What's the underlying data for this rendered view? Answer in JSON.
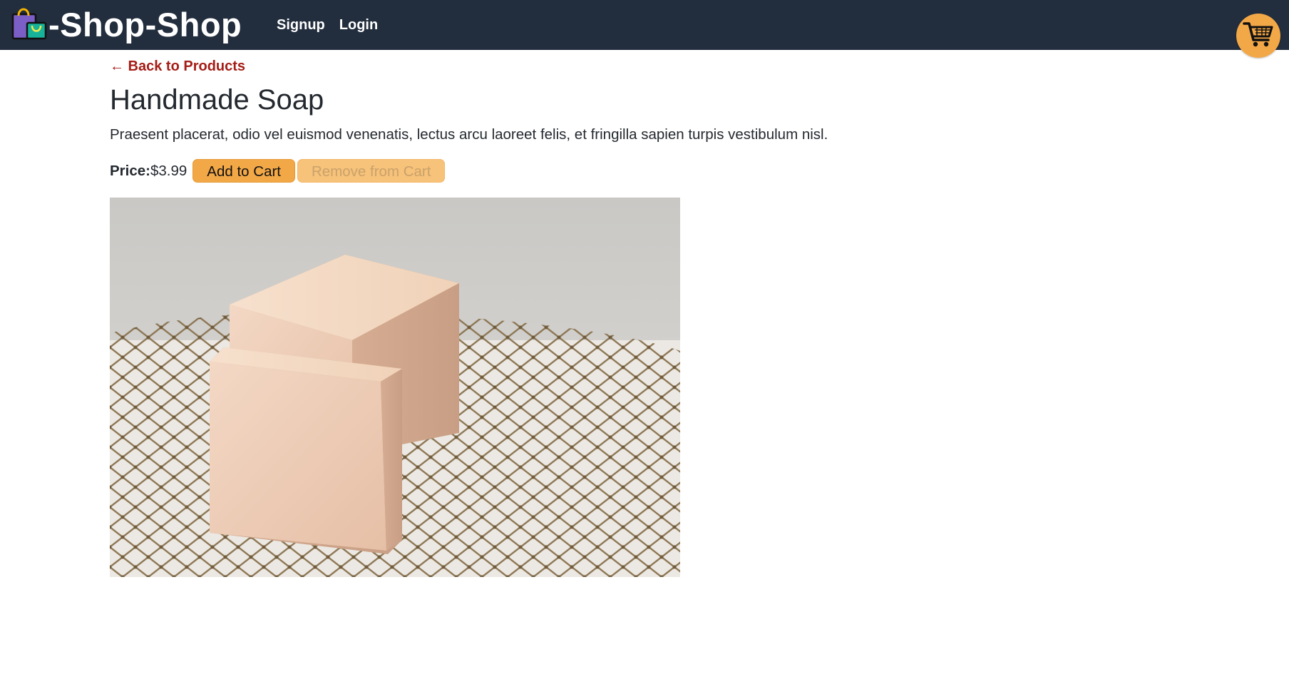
{
  "header": {
    "brand_text": "-Shop-Shop",
    "nav_links": [
      "Signup",
      "Login"
    ],
    "cart_icon": "shopping-cart-icon",
    "brand_icon": "shopping-bags-icon",
    "background_color": "#222d3d",
    "accent_color": "#f3a847"
  },
  "back_link": "← Back to Products",
  "product": {
    "name": "Handmade Soap",
    "description": "Praesent placerat, odio vel euismod venenatis, lectus arcu laoreet felis, et fringilla sapien turpis vestibulum nisl.",
    "price_label": "Price:",
    "price_value": "$3.99",
    "add_button": "Add to Cart",
    "remove_button": "Remove from Cart",
    "remove_disabled": true
  }
}
